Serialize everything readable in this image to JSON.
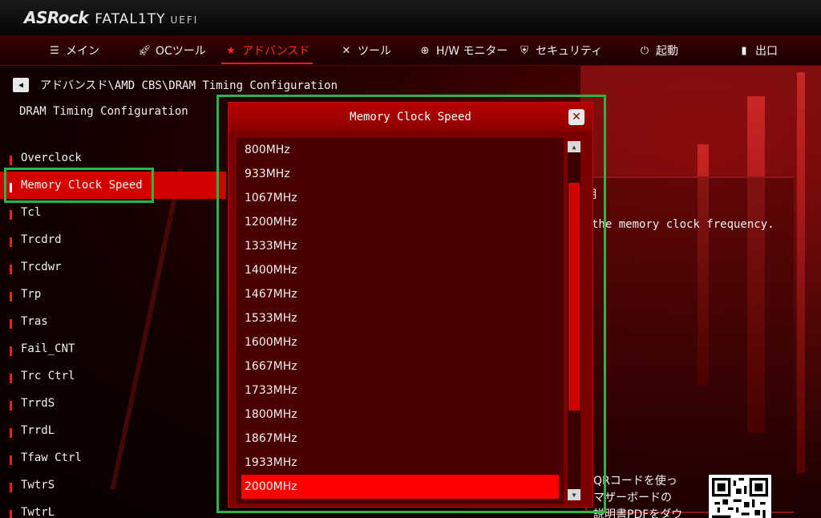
{
  "header": {
    "logo_brand": "ASRock",
    "logo_line": "FATAL1TY",
    "logo_suffix": "UEFI"
  },
  "nav": {
    "items": [
      {
        "label": "メイン",
        "icon": "list-icon"
      },
      {
        "label": "OCツール",
        "icon": "rocket-icon"
      },
      {
        "label": "アドバンスド",
        "icon": "star-icon",
        "active": true
      },
      {
        "label": "ツール",
        "icon": "tools-icon"
      },
      {
        "label": "H/W モニター",
        "icon": "crosshair-icon"
      },
      {
        "label": "セキュリティ",
        "icon": "shield-icon"
      },
      {
        "label": "起動",
        "icon": "power-icon"
      },
      {
        "label": "出口",
        "icon": "exit-icon"
      }
    ]
  },
  "breadcrumb": {
    "path": "アドバンスド\\AMD CBS\\DRAM Timing Configuration"
  },
  "section_title": "DRAM Timing Configuration",
  "menu": {
    "items": [
      "Overclock",
      "Memory Clock Speed",
      "Tcl",
      "Trcdrd",
      "Trcdwr",
      "Trp",
      "Tras",
      "Fail_CNT",
      "Trc Ctrl",
      "TrrdS",
      "TrrdL",
      "Tfaw Ctrl",
      "TwtrS",
      "TwtrL"
    ],
    "selected": "Memory Clock Speed"
  },
  "help": {
    "title": "説明",
    "text": "the memory clock frequency.",
    "qr_lines": [
      "QRコードを使っ",
      "マザーボードの",
      "説明書PDFをダウ"
    ]
  },
  "popup": {
    "title": "Memory Clock Speed",
    "options": [
      "800MHz",
      "933MHz",
      "1067MHz",
      "1200MHz",
      "1333MHz",
      "1400MHz",
      "1467MHz",
      "1533MHz",
      "1600MHz",
      "1667MHz",
      "1733MHz",
      "1800MHz",
      "1867MHz",
      "1933MHz",
      "2000MHz"
    ],
    "selected": "2000MHz"
  },
  "colors": {
    "accent": "#ff1a1a",
    "highlight": "#2db34a",
    "popup_bg": "#7a0000",
    "selected_option": "#ff0000"
  }
}
